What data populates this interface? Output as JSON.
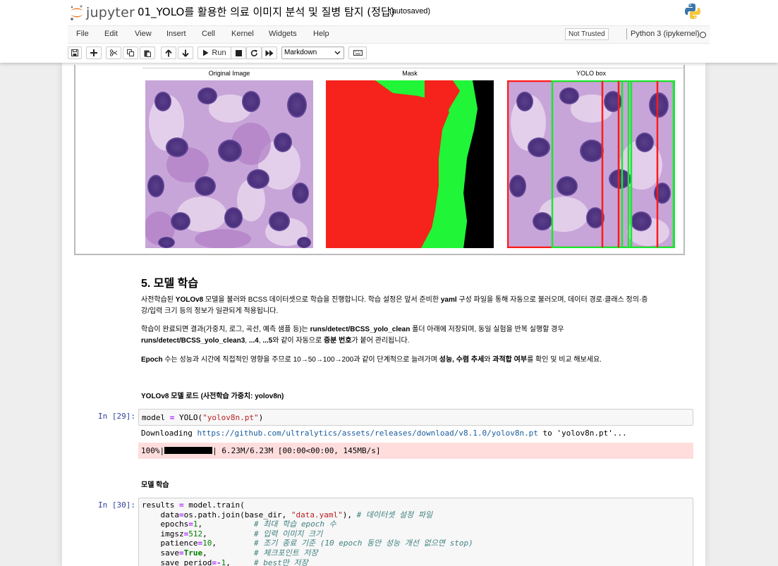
{
  "header": {
    "logo_text": "jupyter",
    "notebook_title": "01_YOLO를 활용한 의료 이미지 분석 및 질병 탐지 (정답)",
    "save_status": "(autosaved)"
  },
  "menubar": {
    "items": [
      "File",
      "Edit",
      "View",
      "Insert",
      "Cell",
      "Kernel",
      "Widgets",
      "Help"
    ],
    "trusted": "Not Trusted",
    "kernel": "Python 3 (ipykernel)"
  },
  "toolbar": {
    "run_label": "Run",
    "cell_type": "Markdown"
  },
  "figure": {
    "titles": [
      "Original Image",
      "Mask",
      "YOLO box"
    ],
    "colors": {
      "mask_red": "#f5231b",
      "mask_green": "#20f538",
      "mask_black": "#000000"
    }
  },
  "markdown": {
    "heading": "5. 모델 학습",
    "p1_a": "사전학습된 ",
    "p1_b": "YOLOv8",
    "p1_c": " 모델을 불러와 BCSS 데이터셋으로 학습을 진행합니다. 학습 설정은 앞서 준비한 ",
    "p1_d": "yaml",
    "p1_e": " 구성 파일을 통해 자동으로 불러오며, 데이터 경로·클래스 정의·증",
    "p1_f": "강/입력 크기 등의 정보가 일관되게 적용됩니다.",
    "p2_a": "학습이 완료되면 결과(가중치, 로그, 곡선, 예측 샘플 등)는 ",
    "p2_b": "runs/detect/BCSS_yolo_clean",
    "p2_c": " 폴더 아래에 저장되며, 동일 실험을 반복 실행할 경우",
    "p2_d": "runs/detect/BCSS_yolo_clean3",
    "p2_e": ", ",
    "p2_f": "...4",
    "p2_g": ", ",
    "p2_h": "...5",
    "p2_i": "와 같이 자동으로 ",
    "p2_j": "증분 번호",
    "p2_k": "가 붙어 관리됩니다.",
    "p3_a": "Epoch",
    "p3_b": " 수는 성능과 시간에 직접적인 영향을 주므로 10→50→100→200과 같이 단계적으로 늘려가며 ",
    "p3_c": "성능, 수렴 추세",
    "p3_d": "와 ",
    "p3_e": "과적합 여부",
    "p3_f": "를 확인 및 비교 해보세요.",
    "h4_load": "YOLOv8 모델 로드 (사전학습 가중치: yolov8n)",
    "h4_train": "모델 학습"
  },
  "cells": {
    "prompt_29": "In [29]:",
    "code_29": {
      "a": "model ",
      "b": "=",
      "c": " YOLO(",
      "d": "\"yolov8n.pt\"",
      "e": ")"
    },
    "out_29_a": "Downloading ",
    "out_29_url": "https://github.com/ultralytics/assets/releases/download/v8.1.0/yolov8n.pt",
    "out_29_b": " to 'yolov8n.pt'...",
    "progress_prefix": "100%|",
    "progress_fraction": 1.0,
    "progress_suffix": "| 6.23M/6.23M [00:00<00:00, 145MB/s]",
    "prompt_30": "In [30]:",
    "code_30": {
      "l1a": "results ",
      "l1b": "=",
      "l1c": " model.train(",
      "l2a": "    data",
      "l2b": "=",
      "l2c": "os.path.join(base_dir, ",
      "l2d": "\"data.yaml\"",
      "l2e": "), ",
      "l2f": "# 데이터셋 설정 파일",
      "l3a": "    epochs",
      "l3b": "=",
      "l3c": "1",
      "l3d": ",           ",
      "l3e": "# 최대 학습 epoch 수",
      "l4a": "    imgsz",
      "l4b": "=",
      "l4c": "512",
      "l4d": ",          ",
      "l4e": "# 입력 이미지 크기",
      "l5a": "    patience",
      "l5b": "=",
      "l5c": "10",
      "l5d": ",        ",
      "l5e": "# 조기 종료 기준 (10 epoch 동안 성능 개선 없으면 stop)",
      "l6a": "    save",
      "l6b": "=",
      "l6c": "True",
      "l6d": ",          ",
      "l6e": "# 체크포인트 저장",
      "l7a": "    save_period",
      "l7b": "=-",
      "l7c": "1",
      "l7d": ",     ",
      "l7e": "# best만 저장"
    }
  }
}
